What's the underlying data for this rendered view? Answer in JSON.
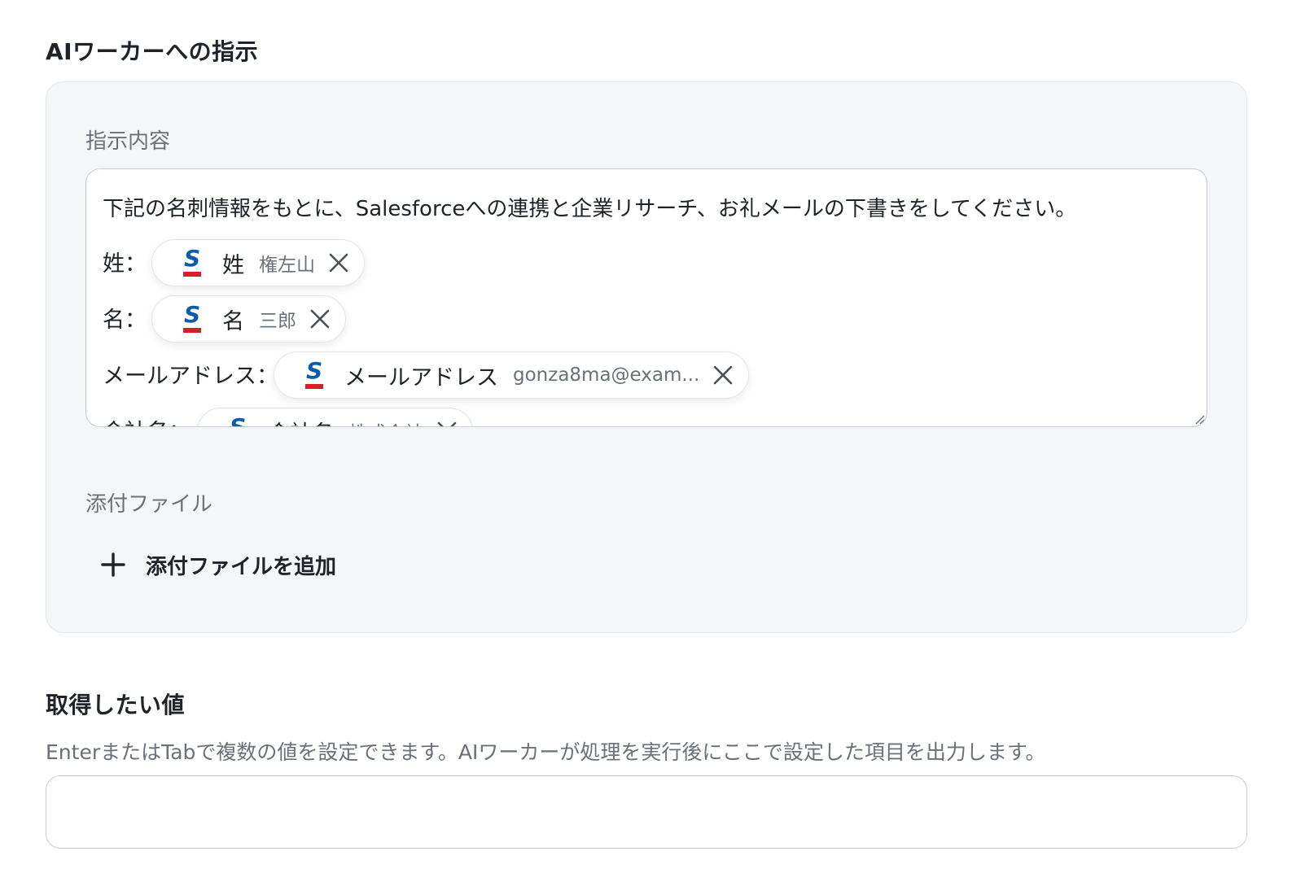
{
  "instructions_section": {
    "title": "AIワーカーへの指示",
    "content_label": "指示内容",
    "intro_text": "下記の名刺情報をもとに、Salesforceへの連携と企業リサーチ、お礼メールの下書きをしてください。",
    "rows": [
      {
        "label": "姓：",
        "chip_name": "姓",
        "chip_value": "権左山",
        "source_icon": "salesforce-icon",
        "remove_icon": "close-icon"
      },
      {
        "label": "名：",
        "chip_name": "名",
        "chip_value": "三郎",
        "source_icon": "salesforce-icon",
        "remove_icon": "close-icon"
      },
      {
        "label": "メールアドレス：",
        "chip_name": "メールアドレス",
        "chip_value": "gonza8ma@exam...",
        "source_icon": "salesforce-icon",
        "remove_icon": "close-icon"
      },
      {
        "label": "会社名：",
        "chip_name": "会社名",
        "chip_value": "株式会社",
        "source_icon": "salesforce-icon",
        "remove_icon": "close-icon"
      }
    ],
    "attachment_label": "添付ファイル",
    "add_attachment_label": "添付ファイルを追加"
  },
  "values_section": {
    "title": "取得したい値",
    "help_text": "EnterまたはTabで複数の値を設定できます。AIワーカーが処理を実行後にここで設定した項目を出力します。",
    "input_value": ""
  },
  "colors": {
    "salesforce_blue": "#0b5cab",
    "salesforce_red": "#d81e28",
    "panel_bg": "#f5f6f8"
  }
}
